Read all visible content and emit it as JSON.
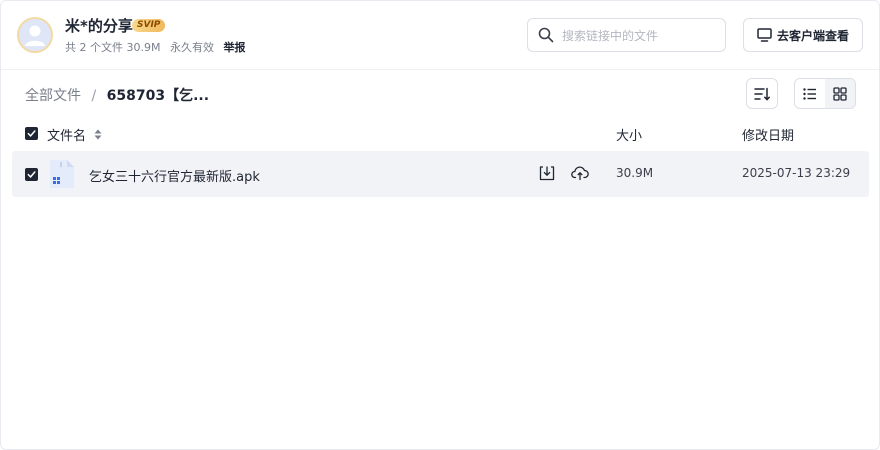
{
  "header": {
    "owner_name": "米*的分享",
    "badge": "SVIP",
    "summary": "共 2 个文件 30.9M",
    "validity": "永久有效",
    "report": "举报",
    "search_placeholder": "搜索链接中的文件",
    "client_button": "去客户端查看"
  },
  "breadcrumb": {
    "root": "全部文件",
    "separator": "/",
    "current": "658703【乞..."
  },
  "table": {
    "columns": {
      "name": "文件名",
      "size": "大小",
      "modified": "修改日期"
    },
    "rows": [
      {
        "name": "乞女三十六行官方最新版.apk",
        "size": "30.9M",
        "modified": "2025-07-13 23:29",
        "checked": true
      }
    ]
  },
  "colors": {
    "accent_dark": "#1f2533",
    "row_bg": "#f2f3f6",
    "badge_gold": "#f0b85c"
  }
}
